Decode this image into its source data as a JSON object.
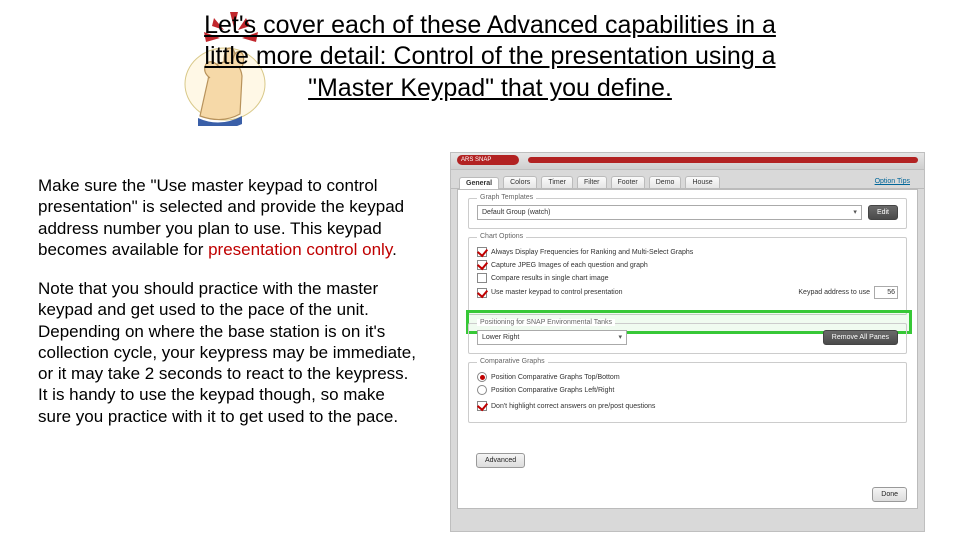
{
  "header": {
    "line": "Let's cover each of these Advanced capabilities in a little more detail: Control of the presentation using a \"Master Keypad\" that you define."
  },
  "body": {
    "p1_pre": "Make sure the \"Use master keypad to control presentation\" is selected and provide the keypad address number you plan to use.  This keypad becomes available for ",
    "p1_red": "presentation control only",
    "p1_post": ".",
    "p2": "Note that you should practice with the master keypad and get used to the pace of the unit.  Depending on where the base station is on it's collection cycle, your keypress may be immediate, or it may take 2 seconds to react to the keypress.  It is handy to use the keypad though, so make sure you practice with it to get used to the pace."
  },
  "dialog": {
    "brand": "ARS SNAP",
    "tabs": [
      "General",
      "Colors",
      "Timer",
      "Filter",
      "Footer",
      "Demo",
      "House"
    ],
    "tab_right": "Option Tips",
    "group1": {
      "title": "Graph Templates",
      "select_value": "Default Group (watch)",
      "edit_btn": "Edit"
    },
    "group2": {
      "title": "Chart Options",
      "opt1": "Always Display Frequencies for Ranking and Multi-Select Graphs",
      "opt2": "Capture JPEG Images of each question and graph",
      "opt3": "Compare results in single chart image",
      "opt4_label": "Use master keypad to control presentation",
      "opt4_side_label": "Keypad address to use",
      "opt4_value": "56"
    },
    "group3": {
      "title": "Positioning for SNAP Environmental Tanks",
      "select_value": "Lower Right",
      "btn": "Remove All Panes"
    },
    "group4": {
      "title": "Comparative Graphs",
      "r1": "Position Comparative Graphs Top/Bottom",
      "r2": "Position Comparative Graphs Left/Right",
      "c1": "Don't highlight correct answers on pre/post questions"
    },
    "advanced_btn": "Advanced",
    "done_btn": "Done"
  }
}
